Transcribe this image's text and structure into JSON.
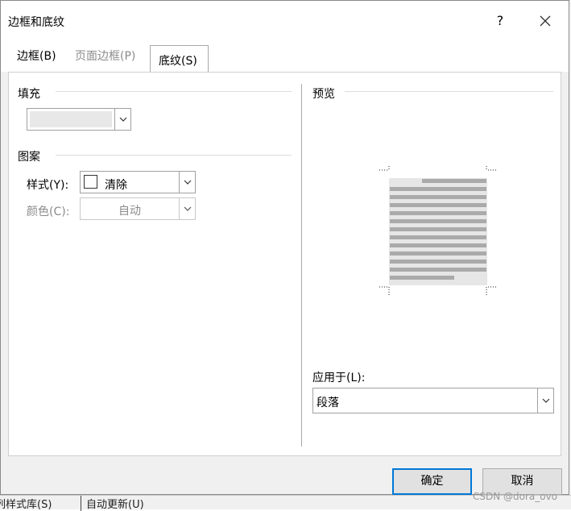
{
  "dialog": {
    "title": "边框和底纹",
    "help": "?"
  },
  "tabs": [
    {
      "label": "边框(B)",
      "accel": "B",
      "state": "normal"
    },
    {
      "label": "页面边框(P)",
      "accel": "P",
      "state": "disabled"
    },
    {
      "label": "底纹(S)",
      "accel": "S",
      "state": "selected"
    }
  ],
  "fill": {
    "label": "填充",
    "value": ""
  },
  "pattern": {
    "label": "图案",
    "style_label": "样式(Y):",
    "style_value": "清除",
    "color_label": "颜色(C):",
    "color_value": "自动"
  },
  "preview": {
    "label": "预览",
    "apply_label": "应用于(L):",
    "apply_value": "段落"
  },
  "buttons": {
    "ok": "确定",
    "cancel": "取消"
  },
  "background": {
    "left_text": "列样式库(S)",
    "right_text": "自动更新(U)"
  },
  "watermark": "CSDN @dora_ovo",
  "colors": {
    "accent": "#0078d7",
    "dialog_bg": "#f0f0f0",
    "preview_lines": "#aaaaaa",
    "preview_page": "#e6e6e6"
  }
}
